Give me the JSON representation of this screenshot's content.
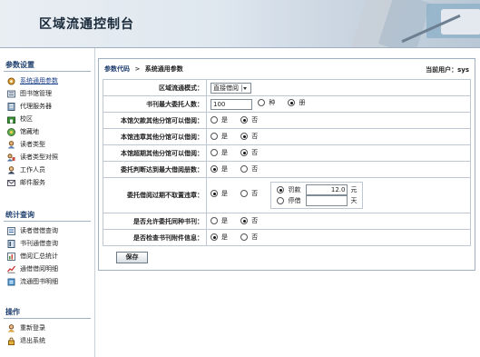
{
  "header": {
    "title": "区域流通控制台"
  },
  "sidebar": {
    "sections": [
      {
        "title": "参数设置",
        "items": [
          {
            "label": "系统通用参数",
            "icon": "gear-icon",
            "active": true
          },
          {
            "label": "图书馆管理",
            "icon": "library-icon"
          },
          {
            "label": "代理服务器",
            "icon": "server-icon"
          },
          {
            "label": "校区",
            "icon": "campus-icon"
          },
          {
            "label": "馆藏地",
            "icon": "location-icon"
          },
          {
            "label": "读者类型",
            "icon": "reader-type-icon"
          },
          {
            "label": "读者类型对照",
            "icon": "reader-map-icon"
          },
          {
            "label": "工作人员",
            "icon": "staff-icon"
          },
          {
            "label": "邮件服务",
            "icon": "mail-icon"
          }
        ]
      },
      {
        "title": "统计查询",
        "items": [
          {
            "label": "读者借借查询",
            "icon": "reader-query-icon"
          },
          {
            "label": "书刊通借查询",
            "icon": "book-query-icon"
          },
          {
            "label": "借阅汇总统计",
            "icon": "summary-icon"
          },
          {
            "label": "通借借阅明细",
            "icon": "detail-icon"
          },
          {
            "label": "流通图书明细",
            "icon": "book-detail-icon"
          }
        ]
      },
      {
        "title": "操作",
        "items": [
          {
            "label": "重新登录",
            "icon": "relogin-icon"
          },
          {
            "label": "退出系统",
            "icon": "logout-icon"
          }
        ]
      }
    ]
  },
  "breadcrumb": {
    "root": "参数代码",
    "separator": ">",
    "current": "系统通用参数"
  },
  "user": {
    "label": "当前用户：",
    "name": "sys"
  },
  "form": {
    "rows": [
      {
        "label": "区域流通模式：",
        "type": "select",
        "value": "直接借阅"
      },
      {
        "label": "书刊最大委托人数：",
        "type": "input-radio",
        "value": "100",
        "options": [
          "种",
          "册"
        ],
        "selected": 1
      },
      {
        "label": "本馆欠款其他分馆可以借阅：",
        "type": "radio",
        "options": [
          "是",
          "否"
        ],
        "selected": 1
      },
      {
        "label": "本馆违章其他分馆可以借阅：",
        "type": "radio",
        "options": [
          "是",
          "否"
        ],
        "selected": 1
      },
      {
        "label": "本馆超期其他分馆可以借阅：",
        "type": "radio",
        "options": [
          "是",
          "否"
        ],
        "selected": 1
      },
      {
        "label": "委托判断达到最大借阅册数：",
        "type": "radio",
        "options": [
          "是",
          "否"
        ],
        "selected": 0
      },
      {
        "label": "委托借阅过期不取置违章：",
        "type": "radio-sub",
        "options": [
          "是",
          "否"
        ],
        "selected": 0,
        "sub": {
          "fine_label": "罚款",
          "fine_value": "12.0",
          "fine_unit": "元",
          "suspend_label": "停借",
          "suspend_value": "",
          "suspend_unit": "天",
          "selected": 0
        }
      },
      {
        "label": "是否允许委托同种书刊：",
        "type": "radio",
        "options": [
          "是",
          "否"
        ],
        "selected": 1
      },
      {
        "label": "是否检查书刊附件信息：",
        "type": "radio",
        "options": [
          "是",
          "否"
        ],
        "selected": 0
      }
    ],
    "save_label": "保存"
  },
  "colors": {
    "accent": "#1f3f6f",
    "border": "#bfc8d2",
    "header_bg": "#dfe7ef"
  }
}
